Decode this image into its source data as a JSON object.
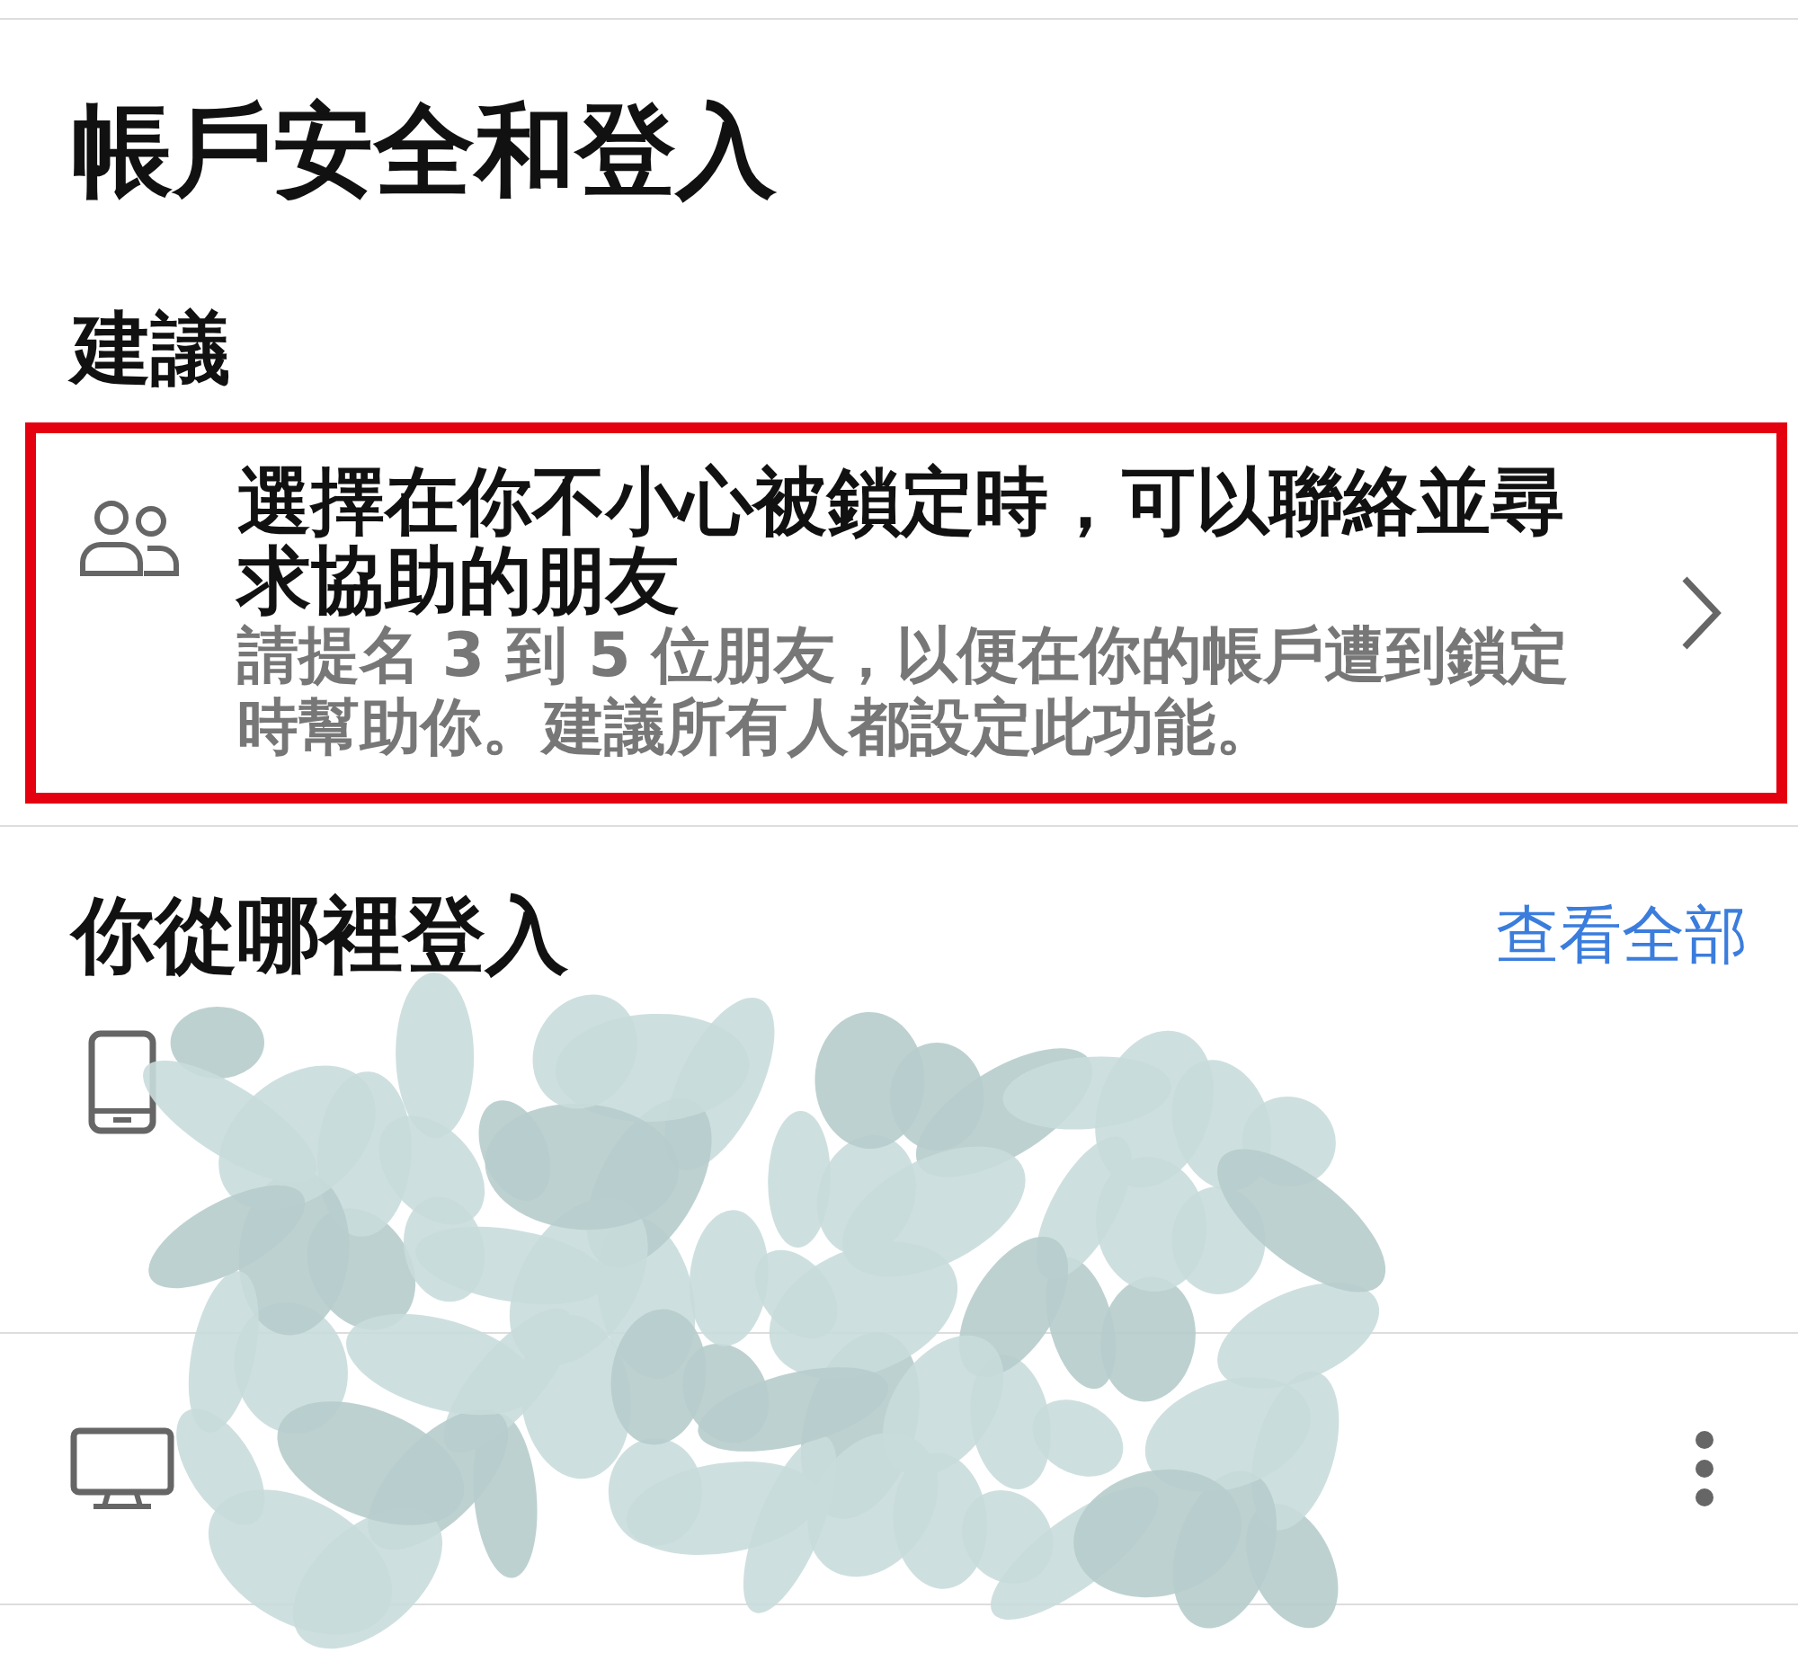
{
  "page_title": "帳戶安全和登入",
  "suggestions": {
    "heading": "建議",
    "card": {
      "title": "選擇在你不小心被鎖定時，可以聯絡並尋求協助的朋友",
      "description": "請提名 3 到 5 位朋友，以便在你的帳戶遭到鎖定時幫助你。建議所有人都設定此功能。",
      "highlighted": true
    }
  },
  "login_section": {
    "heading": "你從哪裡登入",
    "see_all": "查看全部",
    "redacted": true,
    "sessions": [
      {
        "kind": "phone",
        "has_menu": false
      },
      {
        "kind": "desktop",
        "has_menu": true
      }
    ]
  }
}
